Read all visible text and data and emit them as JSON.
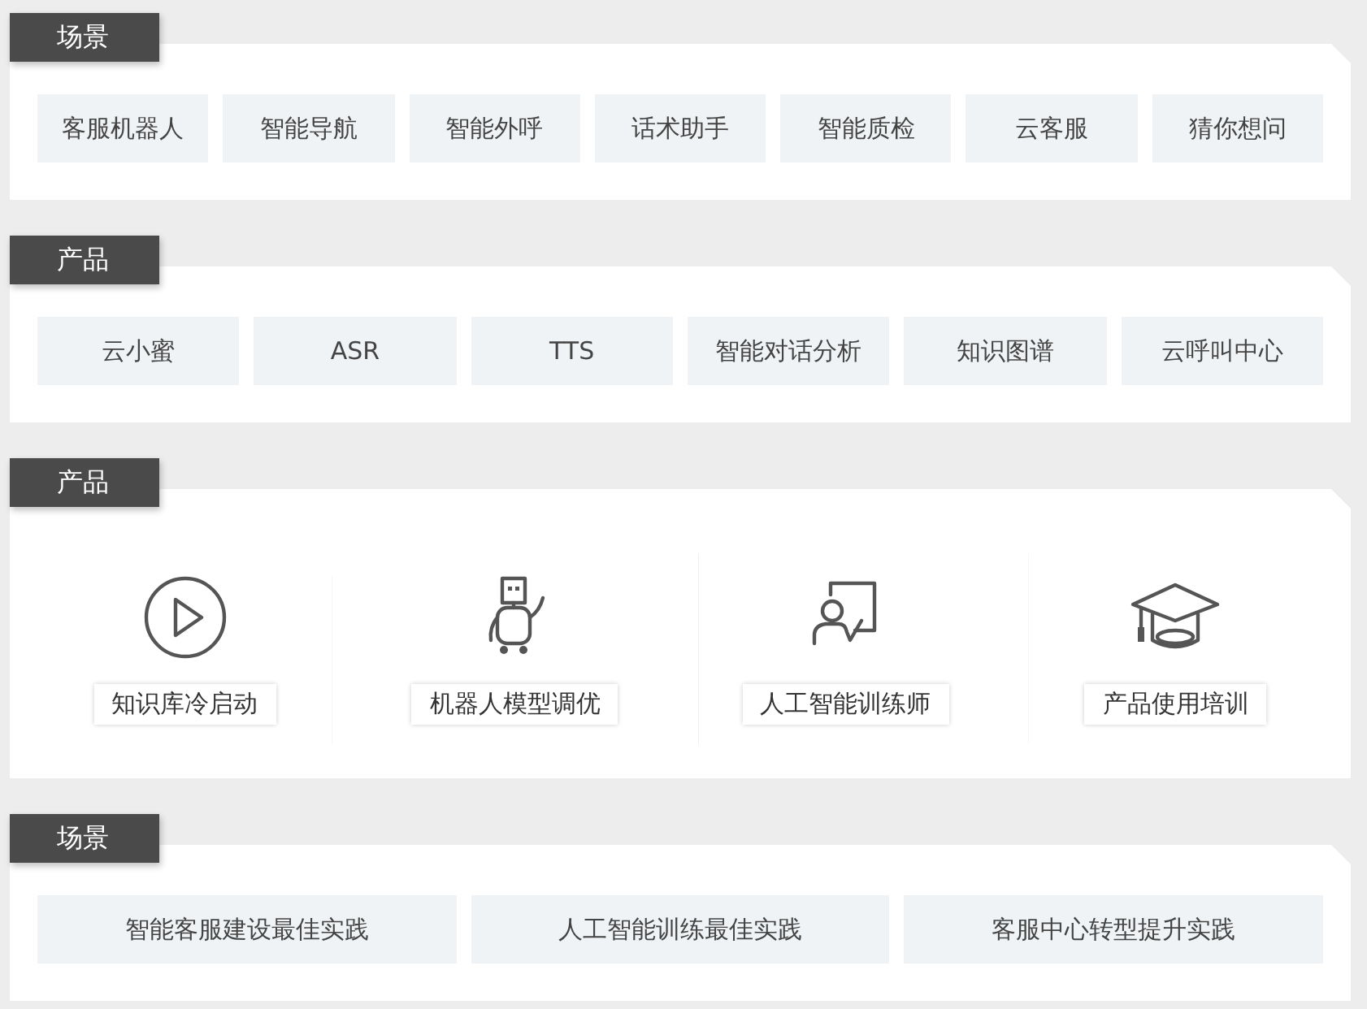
{
  "sections": [
    {
      "title": "场景",
      "kind": "chips",
      "items": [
        "客服机器人",
        "智能导航",
        "智能外呼",
        "话术助手",
        "智能质检",
        "云客服",
        "猜你想问"
      ]
    },
    {
      "title": "产品",
      "kind": "chips",
      "items": [
        "云小蜜",
        "ASR",
        "TTS",
        "智能对话分析",
        "知识图谱",
        "云呼叫中心"
      ]
    },
    {
      "title": "产品",
      "kind": "cards",
      "items": [
        "知识库冷启动",
        "机器人模型调优",
        "人工智能训练师",
        "产品使用培训"
      ]
    },
    {
      "title": "场景",
      "kind": "chips",
      "items": [
        "智能客服建设最佳实践",
        "人工智能训练最佳实践",
        "客服中心转型提升实践"
      ]
    }
  ]
}
